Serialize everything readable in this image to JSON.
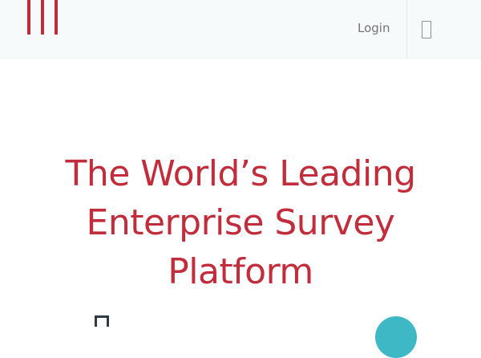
{
  "header": {
    "logo_name": "logo",
    "login_label": "Login",
    "menu_icon": "menu-icon"
  },
  "hero": {
    "title_lines": [
      "The World’s Leading",
      "Enterprise Survey",
      "Platform"
    ]
  },
  "colors": {
    "brand_red": "#c22d3c",
    "header_bg": "#f6fafa",
    "text_gray": "#757575",
    "accent_teal": "#3fb8c6",
    "dark_navy": "#2e3b47"
  },
  "icons": [
    "device-icon",
    "circle-graphic"
  ]
}
